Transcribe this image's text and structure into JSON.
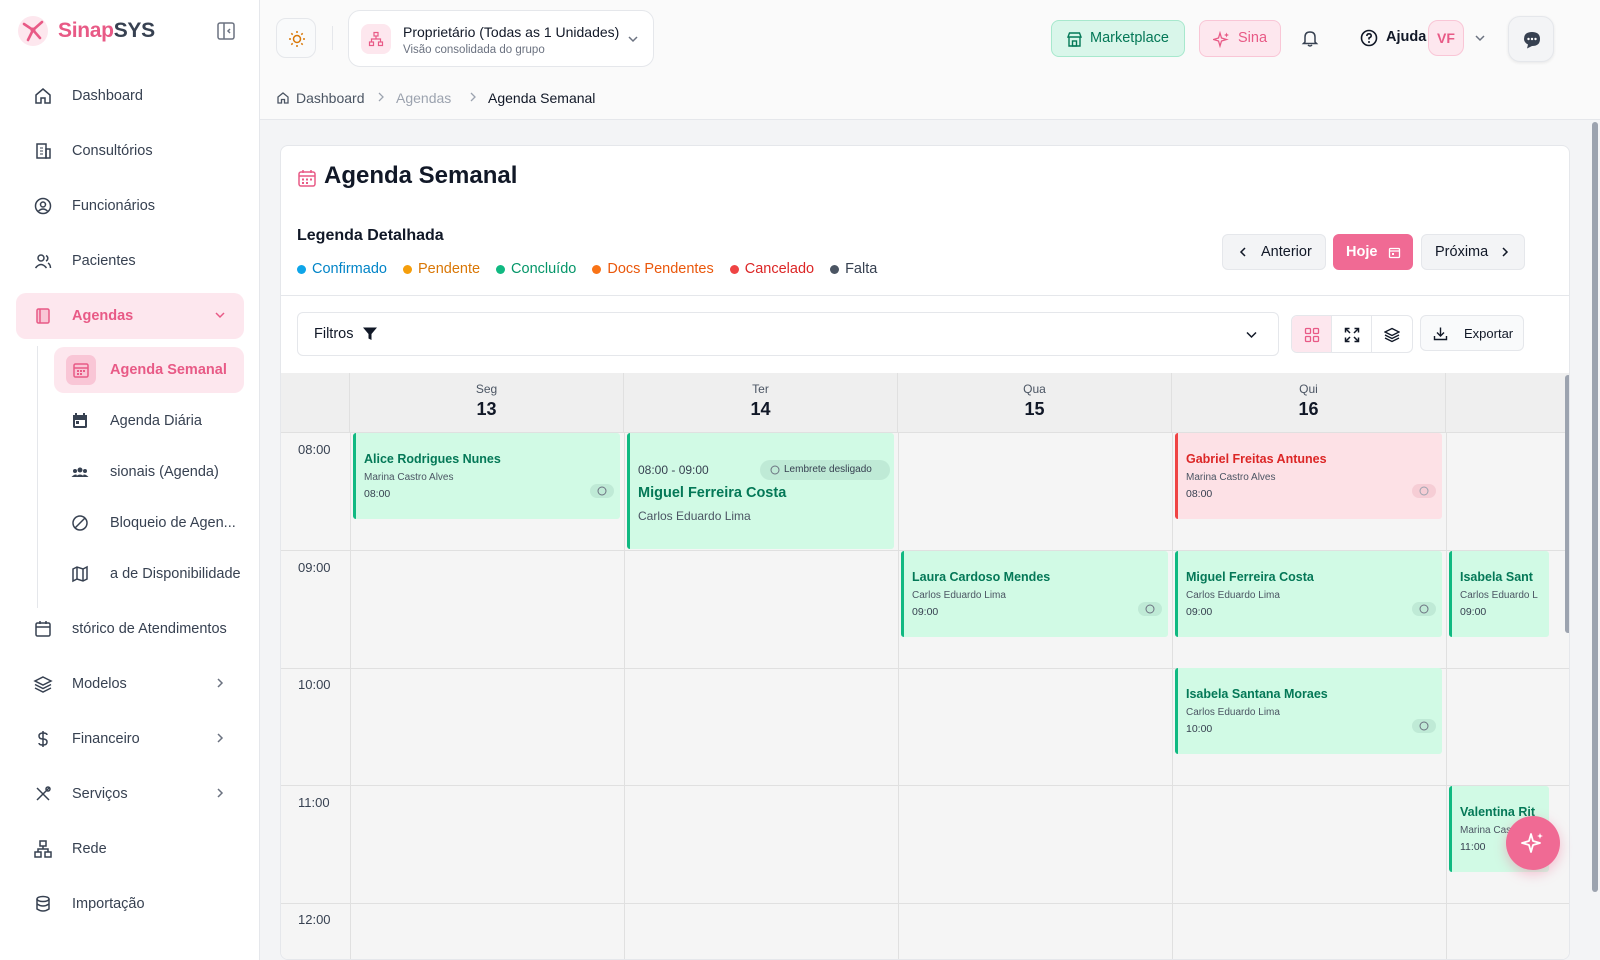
{
  "app": {
    "name_a": "Sinap",
    "name_b": "SYS"
  },
  "sidebar": {
    "items": [
      {
        "label": "Dashboard",
        "icon": "home-icon"
      },
      {
        "label": "Consultórios",
        "icon": "building-icon"
      },
      {
        "label": "Funcionários",
        "icon": "user-circle-icon"
      },
      {
        "label": "Pacientes",
        "icon": "users-icon"
      },
      {
        "label": "Agendas",
        "icon": "book-icon"
      },
      {
        "label": "stórico de Atendimentos",
        "icon": "calendar-icon"
      },
      {
        "label": "Modelos",
        "icon": "layers-icon"
      },
      {
        "label": "Financeiro",
        "icon": "dollar-icon"
      },
      {
        "label": "Serviços",
        "icon": "tools-icon"
      },
      {
        "label": "Rede",
        "icon": "network-icon"
      },
      {
        "label": "Importação",
        "icon": "database-icon"
      }
    ],
    "sub_items": [
      {
        "label": "Agenda Semanal",
        "icon": "calendar-grid-icon"
      },
      {
        "label": "Agenda Diária",
        "icon": "calendar-icon"
      },
      {
        "label": "sionais (Agenda)",
        "icon": "group-icon"
      },
      {
        "label": "Bloqueio de Agen...",
        "icon": "ban-icon"
      },
      {
        "label": "a de Disponibilidade",
        "icon": "map-icon"
      }
    ]
  },
  "topbar": {
    "unit_title": "Proprietário (Todas as 1 Unidades)",
    "unit_subtitle": "Visão consolidada do grupo",
    "marketplace": "Marketplace",
    "sina": "Sina",
    "help": "Ajuda",
    "avatar": "VF"
  },
  "breadcrumb": {
    "c1": "Dashboard",
    "c2": "Agendas",
    "c3": "Agenda Semanal"
  },
  "page": {
    "title": "Agenda Semanal",
    "legend_title": "Legenda Detalhada",
    "legend": [
      {
        "label": "Confirmado",
        "color": "#0ea5e9"
      },
      {
        "label": "Pendente",
        "color": "#f59e0b"
      },
      {
        "label": "Concluído",
        "color": "#10b981"
      },
      {
        "label": "Docs Pendentes",
        "color": "#f97316"
      },
      {
        "label": "Cancelado",
        "color": "#ef4444"
      },
      {
        "label": "Falta",
        "color": "#4b5563"
      }
    ],
    "prev": "Anterior",
    "today": "Hoje",
    "next": "Próxima",
    "filters": "Filtros",
    "export": "Exportar"
  },
  "calendar": {
    "days": [
      {
        "dw": "Seg",
        "dn": "13"
      },
      {
        "dw": "Ter",
        "dn": "14"
      },
      {
        "dw": "Qua",
        "dn": "15"
      },
      {
        "dw": "Qui",
        "dn": "16"
      }
    ],
    "times": [
      "08:00",
      "09:00",
      "10:00",
      "11:00",
      "12:00"
    ],
    "events": [
      {
        "name": "Alice Rodrigues Nunes",
        "prof": "Marina Castro Alves",
        "time": "08:00"
      },
      {
        "range": "08:00 - 09:00",
        "reminder": "Lembrete desligado",
        "name": "Miguel Ferreira Costa",
        "prof": "Carlos Eduardo Lima"
      },
      {
        "name": "Gabriel Freitas Antunes",
        "prof": "Marina Castro Alves",
        "time": "08:00"
      },
      {
        "name": "Laura Cardoso Mendes",
        "prof": "Carlos Eduardo Lima",
        "time": "09:00"
      },
      {
        "name": "Miguel Ferreira Costa",
        "prof": "Carlos Eduardo Lima",
        "time": "09:00"
      },
      {
        "name": "Isabela Sant",
        "prof": "Carlos Eduardo L",
        "time": "09:00"
      },
      {
        "name": "Isabela Santana Moraes",
        "prof": "Carlos Eduardo Lima",
        "time": "10:00"
      },
      {
        "name": "Valentina Rit",
        "prof": "Marina Cas",
        "time": "11:00"
      }
    ]
  }
}
